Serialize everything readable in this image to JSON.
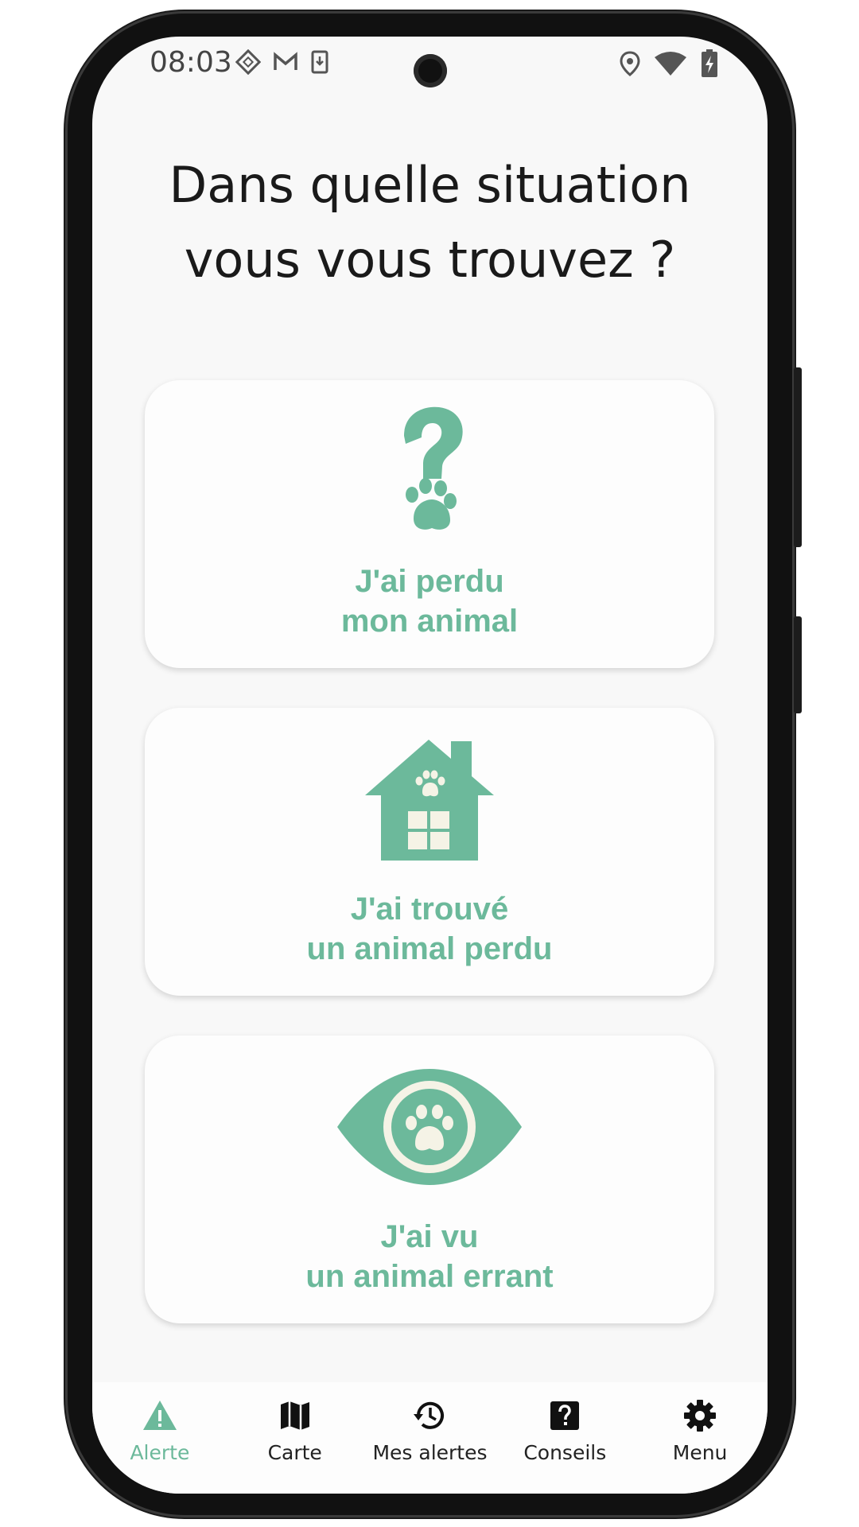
{
  "status_bar": {
    "time": "08:03",
    "left_icons": [
      "nfc-icon",
      "gmail-icon",
      "download-icon"
    ],
    "right_icons": [
      "location-icon",
      "wifi-icon",
      "battery-charging-icon"
    ]
  },
  "heading": {
    "line1": "Dans quelle situation",
    "line2": "vous vous trouvez ?"
  },
  "options": [
    {
      "icon": "question-paw-icon",
      "line1": "J'ai perdu",
      "line2": "mon animal"
    },
    {
      "icon": "house-paw-icon",
      "line1": "J'ai trouvé",
      "line2": "un animal perdu"
    },
    {
      "icon": "eye-paw-icon",
      "line1": "J'ai vu",
      "line2": "un animal errant"
    }
  ],
  "nav": {
    "items": [
      {
        "label": "Alerte",
        "icon": "warning-icon",
        "active": true
      },
      {
        "label": "Carte",
        "icon": "map-icon",
        "active": false
      },
      {
        "label": "Mes alertes",
        "icon": "history-icon",
        "active": false
      },
      {
        "label": "Conseils",
        "icon": "help-icon",
        "active": false
      },
      {
        "label": "Menu",
        "icon": "gear-icon",
        "active": false
      }
    ]
  },
  "colors": {
    "accent": "#6cb99b",
    "icon_fill": "#6cb99b",
    "cream": "#f5f3e6",
    "text": "#1a1a1a",
    "background": "#f8f8f8"
  }
}
